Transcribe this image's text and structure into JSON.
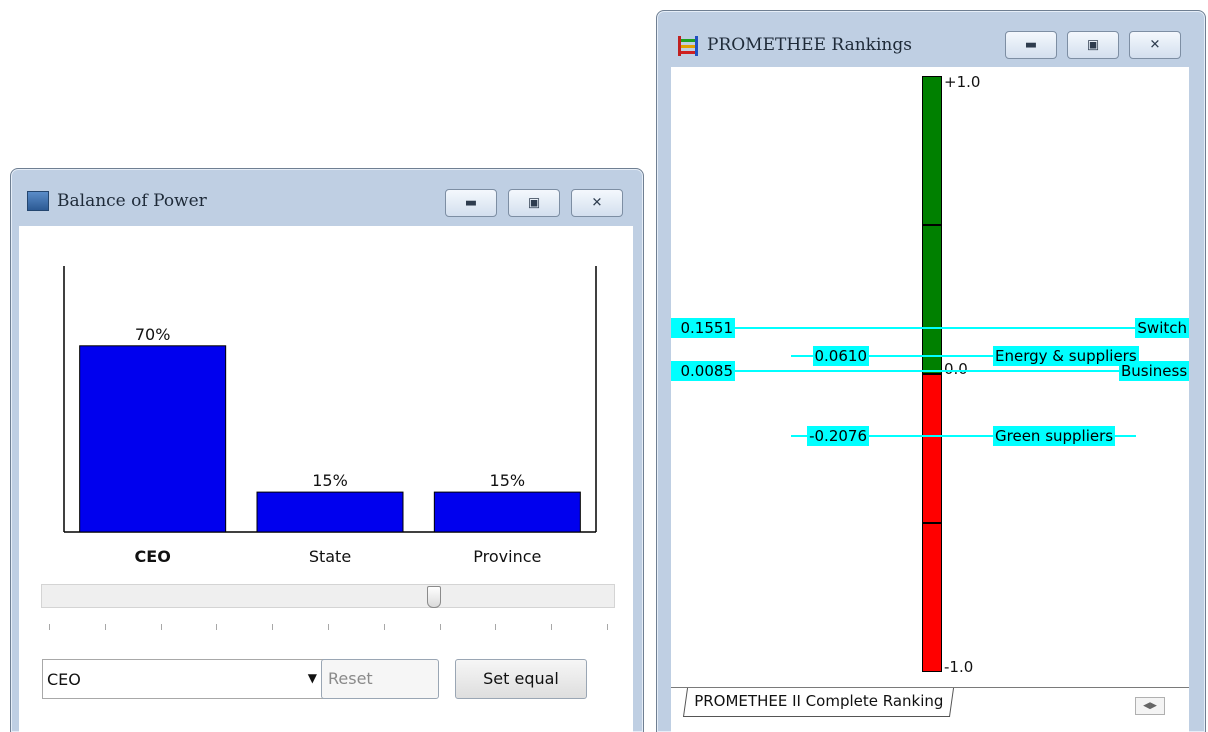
{
  "balance_window": {
    "title": "Balance of Power",
    "bars": [
      {
        "category": "CEO",
        "value": 70,
        "label": "70%",
        "bold": true
      },
      {
        "category": "State",
        "value": 15,
        "label": "15%",
        "bold": false
      },
      {
        "category": "Province",
        "value": 15,
        "label": "15%",
        "bold": false
      }
    ],
    "bar_color": "#0000ee",
    "slider_value_percent": 70,
    "dropdown_value": "CEO",
    "reset_label": "Reset",
    "set_equal_label": "Set equal"
  },
  "promethee_window": {
    "title": "PROMETHEE Rankings",
    "top_label": "+1.0",
    "zero_label": "0.0",
    "bottom_label": "-1.0",
    "tab_label": "PROMETHEE II Complete Ranking",
    "positive_color": "#008000",
    "negative_color": "#ff0000",
    "highlight_color": "#00ffff",
    "rankings": [
      {
        "score": "0.1551",
        "name": "Switch"
      },
      {
        "score": "0.0610",
        "name": "Energy & suppliers"
      },
      {
        "score": "0.0085",
        "name": "Business"
      },
      {
        "score": "-0.2076",
        "name": "Green suppliers"
      }
    ]
  },
  "chart_data": [
    {
      "type": "bar",
      "categories": [
        "CEO",
        "State",
        "Province"
      ],
      "values": [
        70,
        15,
        15
      ],
      "title": "Balance of Power",
      "ylim": [
        0,
        100
      ]
    },
    {
      "type": "bar",
      "title": "PROMETHEE Rankings",
      "categories": [
        "Switch",
        "Energy & suppliers",
        "Business",
        "Green suppliers"
      ],
      "values": [
        0.1551,
        0.061,
        0.0085,
        -0.2076
      ],
      "ylim": [
        -1.0,
        1.0
      ]
    }
  ]
}
